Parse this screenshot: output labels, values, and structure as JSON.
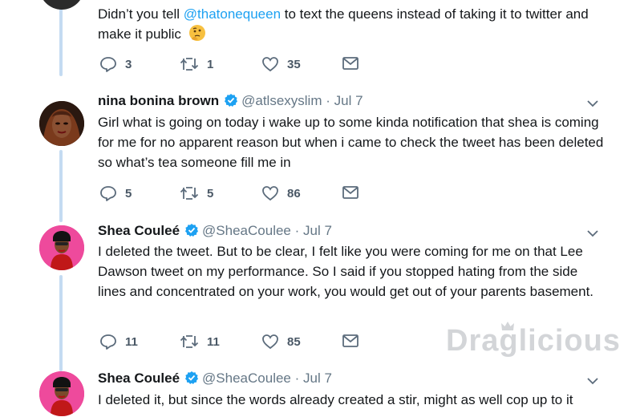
{
  "tweet0": {
    "text_before": "Didn’t you tell ",
    "mention": "@thatonequeen",
    "text_after": " to text the queens instead of taking it to twitter and make it public",
    "emoji": "thinking-face-emoji",
    "replies": "3",
    "retweets": "1",
    "likes": "35"
  },
  "tweet1": {
    "name": "nina bonina brown",
    "handle": "@atlsexyslim",
    "date": "· Jul 7",
    "text": "Girl what is going on today i wake up to some kinda notification that shea is coming for me for no apparent reason but when i came to check the tweet has been deleted so what’s tea someone fill me in",
    "replies": "5",
    "retweets": "5",
    "likes": "86"
  },
  "tweet2": {
    "name": "Shea Couleé",
    "handle": "@SheaCoulee",
    "date": "· Jul 7",
    "text": "I deleted the tweet. But to be clear, I felt like you were coming for me on that Lee Dawson tweet on my performance. So I said if you stopped hating from the side lines and concentrated on your work, you would get out of your parents basement.",
    "replies": "11",
    "retweets": "11",
    "likes": "85"
  },
  "tweet3": {
    "name": "Shea Couleé",
    "handle": "@SheaCoulee",
    "date": "· Jul 7",
    "text": "I deleted it, but since the words already created a stir, might as well cop up to it"
  },
  "watermark": "Draglicious",
  "colors": {
    "accent": "#1da1f2",
    "thread_line": "#c4dbf2",
    "verified": "#1da1f2",
    "muted": "#657786"
  }
}
